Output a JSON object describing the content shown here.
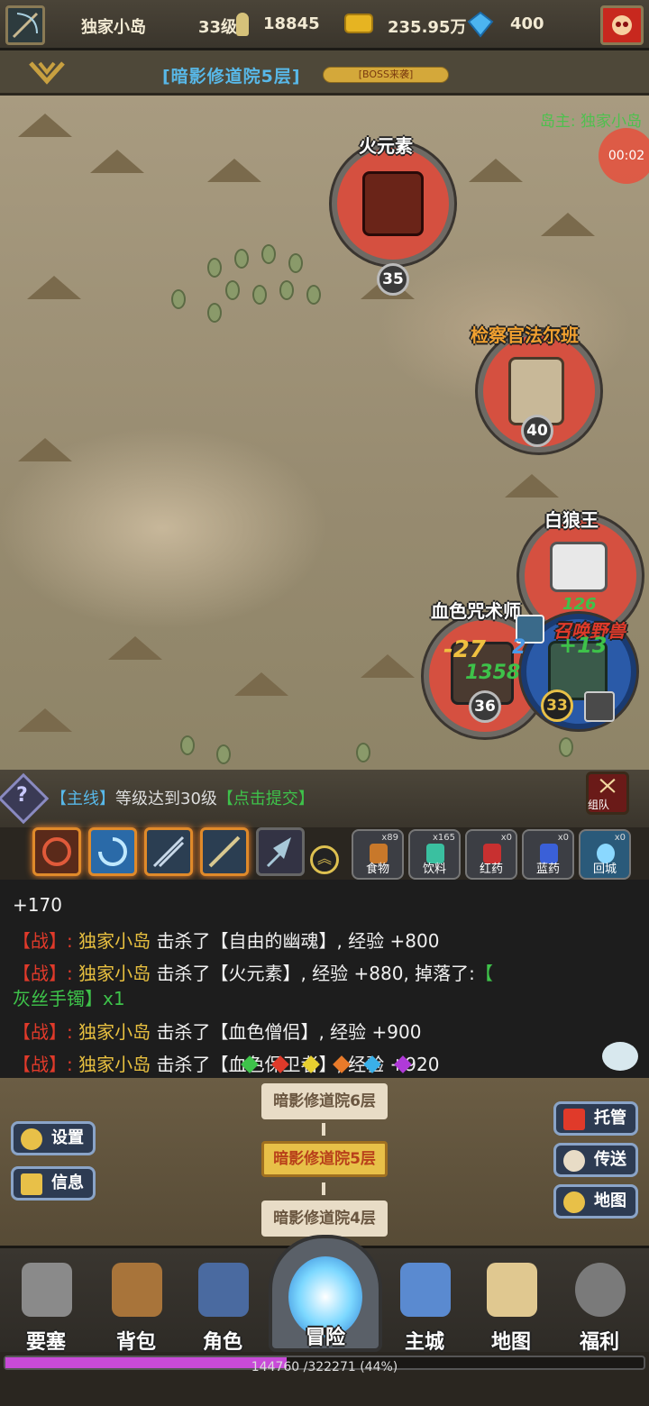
{
  "header": {
    "player_name": "独家小岛",
    "level": "33级",
    "power": "18845",
    "gold": "235.95万",
    "diamonds": "400"
  },
  "dungeon": {
    "title": "[暗影修道院5层]",
    "boss_label": "[BOSS来袭]"
  },
  "map": {
    "owner": "岛主: 独家小岛",
    "timer": "00:02",
    "enemies": [
      {
        "name": "火元素",
        "level": "35"
      },
      {
        "name": "检察官法尔班",
        "level": "40"
      },
      {
        "name": "白狼王",
        "level": ""
      },
      {
        "name": "血色咒术师",
        "level": "36"
      }
    ],
    "player_level": "33",
    "summon_label": "召唤野兽",
    "damage": [
      "-27",
      "2",
      "1358",
      "+13",
      "126"
    ]
  },
  "quest": {
    "tag": "【主线】",
    "text": "等级达到30级",
    "action": "【点击提交】",
    "team_label": "组队"
  },
  "items": [
    {
      "label": "食物",
      "count": "x89"
    },
    {
      "label": "饮料",
      "count": "x165"
    },
    {
      "label": "红药",
      "count": "x0"
    },
    {
      "label": "蓝药",
      "count": "x0"
    },
    {
      "label": "回城",
      "count": "x0"
    }
  ],
  "chat": {
    "line0": "+170",
    "line1_tag": "【战】:",
    "line1_name": "独家小岛",
    "line1_text": "击杀了【自由的幽魂】, 经验 +800",
    "line2_tag": "【战】:",
    "line2_name": "独家小岛",
    "line2_text": "击杀了【火元素】, 经验 +880, 掉落了:",
    "line2_drop1": "【",
    "line2_drop2": "灰丝手镯】x1",
    "line3_tag": "【战】:",
    "line3_name": "独家小岛",
    "line3_text": "击杀了【血色僧侣】, 经验 +900",
    "line4_tag": "【战】:",
    "line4_name": "独家小岛",
    "line4_text": "击杀了【血色保卫者】, 经验 +920"
  },
  "floors": {
    "up": "暗影修道院6层",
    "current": "暗影修道院5层",
    "down": "暗影修道院4层"
  },
  "side_buttons": {
    "settings": "设置",
    "info": "信息",
    "auto": "托管",
    "teleport": "传送",
    "map": "地图"
  },
  "nav": [
    "要塞",
    "背包",
    "角色",
    "冒险",
    "主城",
    "地图",
    "福利"
  ],
  "xp": {
    "text": "144760 /322271 (44%)",
    "fraction": 0.44
  },
  "colors": {
    "accent": "#e8c048",
    "enemy_ring": "#d55040",
    "xp": "#c84ad8"
  }
}
